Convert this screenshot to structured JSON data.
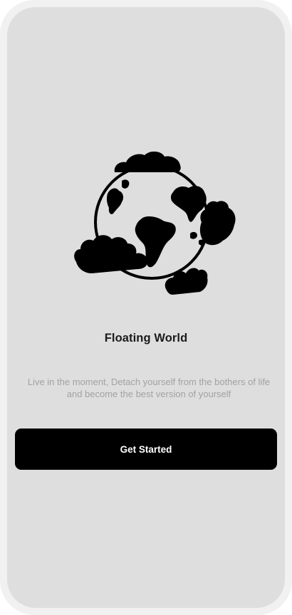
{
  "onboarding": {
    "illustration_icon": "floating-globe-with-clouds",
    "title": "Floating World",
    "subtitle_line1": "Live in the moment, Detach yourself from the bothers of life",
    "subtitle_line2": "and become the best version of yourself",
    "cta_label": "Get Started"
  },
  "colors": {
    "frame": "#f1f1f1",
    "screen_background": "#dedede",
    "title_text": "#1b1b1b",
    "subtitle_text": "#a2a2a2",
    "button_background": "#000000",
    "button_text": "#ffffff"
  }
}
